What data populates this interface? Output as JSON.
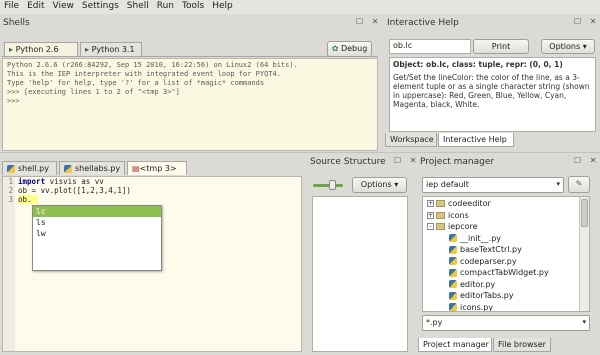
{
  "menu": [
    "File",
    "Edit",
    "View",
    "Settings",
    "Shell",
    "Run",
    "Tools",
    "Help"
  ],
  "shells": {
    "title": "Shells",
    "tabs": [
      "Python 2.6",
      "Python 3.1"
    ],
    "debug_label": "Debug",
    "lines": [
      "Python 2.6.6 (r266:84292, Sep 15 2010, 16:22:56) on Linux2 (64 bits).",
      "This is the IEP interpreter with integrated event loop for PYQT4.",
      "Type 'help' for help, type '?' for a list of *magic* commands",
      ">>> [executing lines 1 to 2 of \"<tmp 3>\"]",
      ">>>"
    ]
  },
  "help": {
    "title": "Interactive Help",
    "search_value": "ob.lc",
    "print_label": "Print",
    "options_label": "Options",
    "object_line": "Object: ob.lc, class: tuple, repr: (0, 0, 1)",
    "body": "Get/Set the lineColor: the color of the line, as a 3-element tuple or as a single character string (shown in uppercase): Red, Green, Blue, Yellow, Cyan, Magenta, black, White.",
    "tabs": [
      "Workspace",
      "Interactive Help"
    ]
  },
  "editor": {
    "tabs": [
      "shell.py",
      "shellabs.py",
      "<tmp 3>"
    ],
    "line_numbers": [
      "1",
      "2",
      "3"
    ],
    "code": [
      {
        "kw": "import",
        "rest": " visvis as vv"
      },
      {
        "kw": "",
        "rest": "ob = vv.plot([1,2,3,4,1])"
      },
      {
        "kw": "",
        "rest": "ob."
      }
    ],
    "autocomplete": [
      "lc",
      "ls",
      "lw"
    ]
  },
  "source_structure": {
    "title": "Source Structure",
    "options_label": "Options"
  },
  "project_manager": {
    "title": "Project manager",
    "project_select": "iep default",
    "tree": [
      {
        "type": "folder",
        "label": "codeeditor",
        "expand": "+"
      },
      {
        "type": "folder",
        "label": "icons",
        "expand": "+"
      },
      {
        "type": "folder",
        "label": "iepcore",
        "expand": "-"
      },
      {
        "type": "file",
        "label": "__init__.py"
      },
      {
        "type": "file",
        "label": "baseTextCtrl.py"
      },
      {
        "type": "file",
        "label": "codeparser.py"
      },
      {
        "type": "file",
        "label": "compactTabWidget.py"
      },
      {
        "type": "file",
        "label": "editor.py"
      },
      {
        "type": "file",
        "label": "editorTabs.py"
      },
      {
        "type": "file",
        "label": "icons.py"
      }
    ],
    "filter_value": "*.py",
    "tabs": [
      "Project manager",
      "File browser"
    ]
  }
}
